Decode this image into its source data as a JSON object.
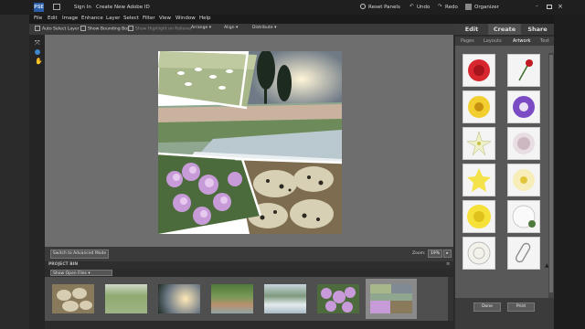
{
  "topbar": {
    "logo": "PSE",
    "sign_in": "Sign In",
    "create_id": "Create New Adobe ID",
    "reset_panels": "Reset Panels",
    "undo": "Undo",
    "redo": "Redo",
    "organizer": "Organizer"
  },
  "menu": [
    "File",
    "Edit",
    "Image",
    "Enhance",
    "Layer",
    "Select",
    "Filter",
    "View",
    "Window",
    "Help"
  ],
  "options": {
    "auto_select": "Auto Select Layer",
    "bounding_box": "Show Bounding Box",
    "highlight": "Show Highlight on Rollover",
    "arrange": "Arrange",
    "align": "Align",
    "distribute": "Distribute"
  },
  "tabs": [
    "Edit",
    "Create",
    "Share"
  ],
  "subtabs": [
    "Pages",
    "Layouts",
    "Artwork",
    "Text"
  ],
  "canvas": {
    "advanced_button": "Switch to Advanced Mode",
    "zoom_label": "Zoom:",
    "zoom_value": "19%"
  },
  "project_bin": {
    "title": "PROJECT BIN",
    "dropdown": "Show Open Files"
  },
  "panel": {
    "done": "Done",
    "print": "Print"
  },
  "colors": {
    "accent_blue": "#2a5fa8",
    "panel_bg": "#585858",
    "canvas_bg": "#6e6e6e"
  },
  "icons": [
    "move-tool-icon",
    "zoom-tool-icon",
    "hand-tool-icon",
    "undo-icon",
    "redo-icon",
    "reset-panels-icon",
    "organizer-icon"
  ]
}
